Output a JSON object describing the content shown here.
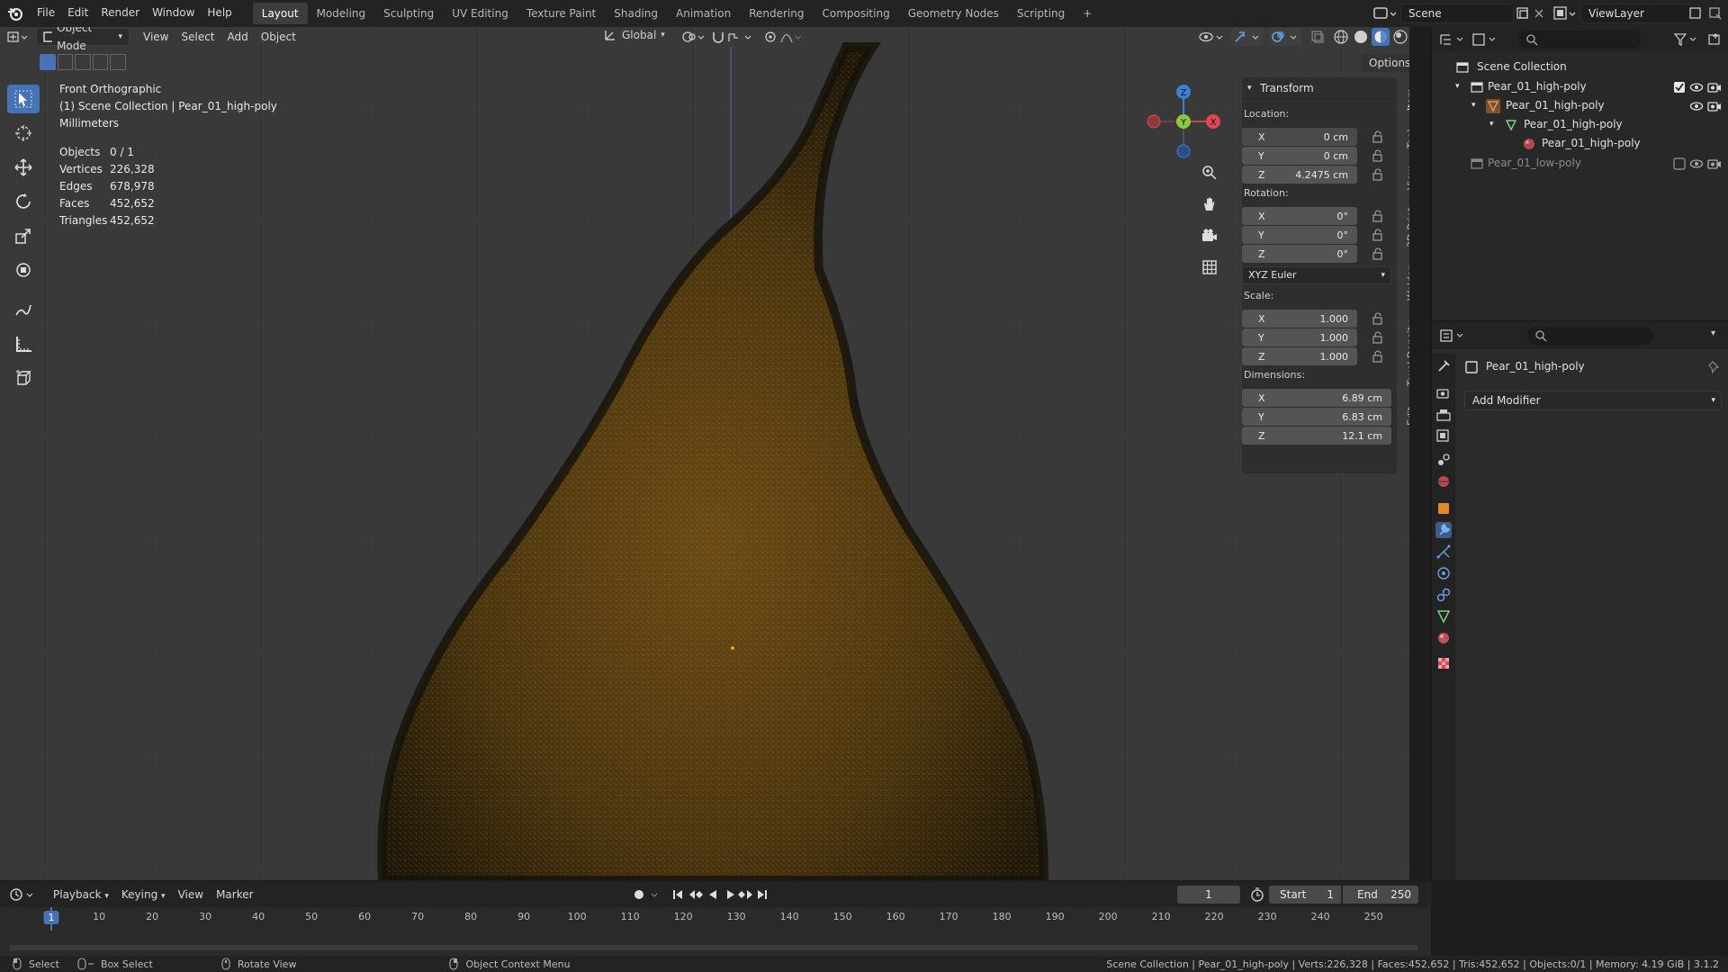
{
  "menubar": {
    "items": [
      "File",
      "Edit",
      "Render",
      "Window",
      "Help"
    ],
    "workspaces": [
      "Layout",
      "Modeling",
      "Sculpting",
      "UV Editing",
      "Texture Paint",
      "Shading",
      "Animation",
      "Rendering",
      "Compositing",
      "Geometry Nodes",
      "Scripting"
    ],
    "active_workspace": "Layout",
    "add_tab": "+",
    "scene_name": "Scene",
    "view_layer": "ViewLayer"
  },
  "viewport_header": {
    "mode": "Object Mode",
    "menus": [
      "View",
      "Select",
      "Add",
      "Object"
    ],
    "orientation": "Global",
    "options": "Options"
  },
  "viewport_overlay": {
    "view_name": "Front Orthographic",
    "collection_path": "(1) Scene Collection | Pear_01_high-poly",
    "units": "Millimeters",
    "stats": [
      {
        "label": "Objects",
        "value": "0 / 1"
      },
      {
        "label": "Vertices",
        "value": "226,328"
      },
      {
        "label": "Edges",
        "value": "678,978"
      },
      {
        "label": "Faces",
        "value": "452,652"
      },
      {
        "label": "Triangles",
        "value": "452,652"
      }
    ]
  },
  "gizmo": {
    "x": "X",
    "y": "Y",
    "z": "Z"
  },
  "npanel": {
    "title": "Transform",
    "location_label": "Location:",
    "location": [
      {
        "axis": "X",
        "value": "0 cm"
      },
      {
        "axis": "Y",
        "value": "0 cm"
      },
      {
        "axis": "Z",
        "value": "4.2475 cm"
      }
    ],
    "rotation_label": "Rotation:",
    "rotation": [
      {
        "axis": "X",
        "value": "0°"
      },
      {
        "axis": "Y",
        "value": "0°"
      },
      {
        "axis": "Z",
        "value": "0°"
      }
    ],
    "rotation_mode": "XYZ Euler",
    "scale_label": "Scale:",
    "scale": [
      {
        "axis": "X",
        "value": "1.000"
      },
      {
        "axis": "Y",
        "value": "1.000"
      },
      {
        "axis": "Z",
        "value": "1.000"
      }
    ],
    "dimensions_label": "Dimensions:",
    "dimensions": [
      {
        "axis": "X",
        "value": "6.89 cm"
      },
      {
        "axis": "Y",
        "value": "6.83 cm"
      },
      {
        "axis": "Z",
        "value": "12.1 cm"
      }
    ],
    "tabs": [
      "Item",
      "Tool",
      "View",
      "3D-Print",
      "Welder",
      "Texel Density",
      "Edit"
    ]
  },
  "outliner": {
    "root": "Scene Collection",
    "rows": [
      "Pear_01_high-poly",
      "Pear_01_high-poly",
      "Pear_01_high-poly",
      "Pear_01_high-poly",
      "Pear_01_low-poly"
    ]
  },
  "properties": {
    "object_name": "Pear_01_high-poly",
    "add_modifier": "Add Modifier"
  },
  "timeline": {
    "menus": [
      "Playback",
      "Keying",
      "View",
      "Marker"
    ],
    "current_frame": "1",
    "start_label": "Start",
    "start": "1",
    "end_label": "End",
    "end": "250",
    "frames": [
      "1",
      "10",
      "20",
      "30",
      "40",
      "50",
      "60",
      "70",
      "80",
      "90",
      "100",
      "110",
      "120",
      "130",
      "140",
      "150",
      "160",
      "170",
      "180",
      "190",
      "200",
      "210",
      "220",
      "230",
      "240",
      "250"
    ]
  },
  "statusbar": {
    "select": "Select",
    "box_select": "Box Select",
    "rotate_view": "Rotate View",
    "context_menu": "Object Context Menu",
    "info": "Scene Collection | Pear_01_high-poly | Verts:226,328 | Faces:452,652 | Tris:452,652 | Objects:0/1 | Memory: 4.19 GiB | 3.1.2"
  }
}
